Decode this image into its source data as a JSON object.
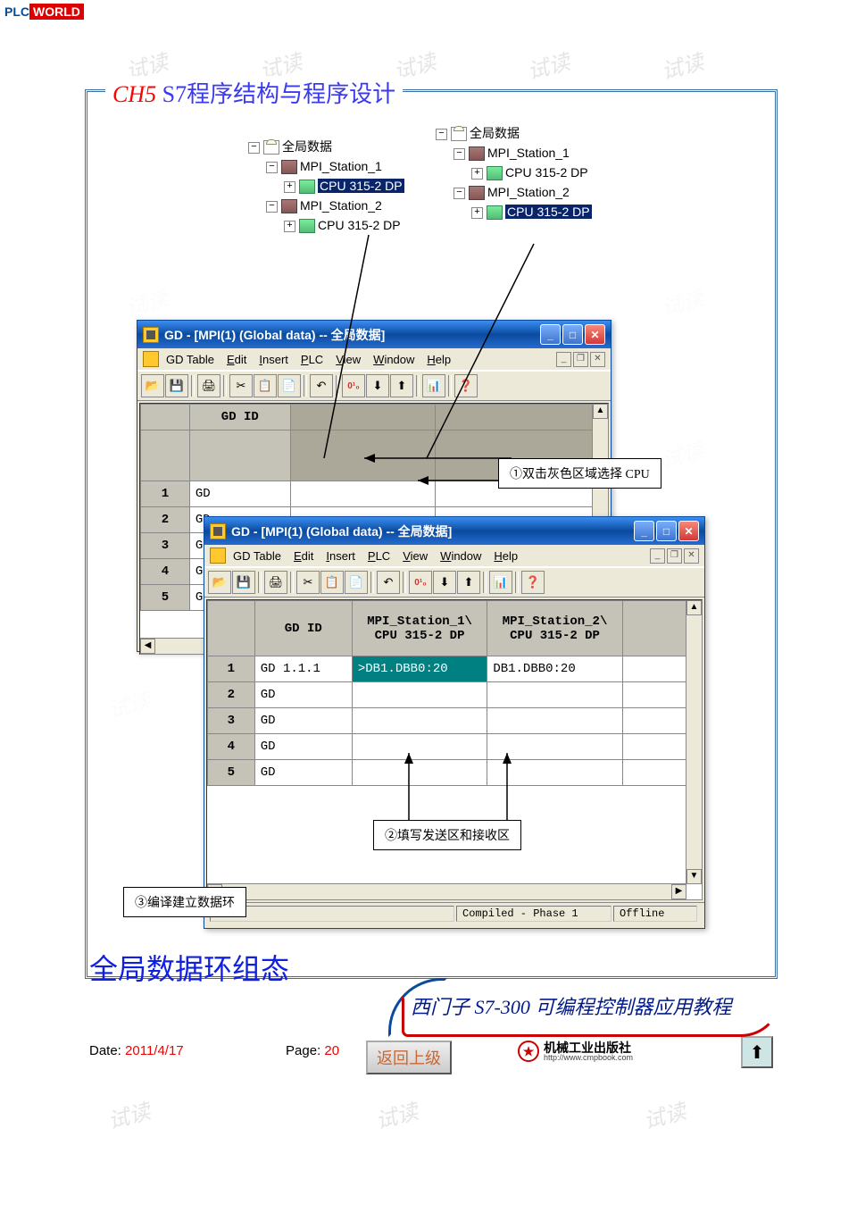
{
  "logo": {
    "p": "PLC",
    "w": "WORLD"
  },
  "watermark": "试读",
  "frame_title": {
    "chapter": "CH5",
    "text": "S7程序结构与程序设计"
  },
  "tree1": {
    "root": "全局数据",
    "s1": "MPI_Station_1",
    "c1": "CPU 315-2 DP",
    "s2": "MPI_Station_2",
    "c2": "CPU 315-2 DP"
  },
  "tree2": {
    "root": "全局数据",
    "s1": "MPI_Station_1",
    "c1": "CPU 315-2 DP",
    "s2": "MPI_Station_2",
    "c2": "CPU 315-2 DP"
  },
  "win1": {
    "title": "GD - [MPI(1) (Global data) -- 全局数据]",
    "menu": {
      "table": "GD Table",
      "edit": "Edit",
      "insert": "Insert",
      "plc": "PLC",
      "view": "View",
      "window": "Window",
      "help": "Help"
    },
    "col_gdid": "GD ID",
    "rows": [
      "GD",
      "GD",
      "GD",
      "GD",
      "GD"
    ]
  },
  "win2": {
    "title": "GD - [MPI(1) (Global data) -- 全局数据]",
    "menu": {
      "table": "GD Table",
      "edit": "Edit",
      "insert": "Insert",
      "plc": "PLC",
      "view": "View",
      "window": "Window",
      "help": "Help"
    },
    "col_gdid": "GD ID",
    "col_s1": "MPI_Station_1\\\nCPU 315-2 DP",
    "col_s2": "MPI_Station_2\\\nCPU 315-2 DP",
    "row1_id": "GD 1.1.1",
    "row1_v1": ">DB1.DBB0:20",
    "row1_v2": "DB1.DBB0:20",
    "rows_rest": [
      "GD",
      "GD",
      "GD",
      "GD"
    ],
    "status_left": "Compiled - Phase 1",
    "status_right": "Offline"
  },
  "callouts": {
    "c1": "①双击灰色区域选择 CPU",
    "c2": "②填写发送区和接收区",
    "c3": "③编译建立数据环"
  },
  "subtitle": "全局数据环组态",
  "book_title": "西门子 S7-300 可编程控制器应用教程",
  "footer": {
    "date_label": "Date: ",
    "date_value": "2011/4/17",
    "page_label": "Page: ",
    "page_value": "20",
    "return_btn": "返回上级",
    "publisher": "机械工业出版社",
    "publisher_url": "http://www.cmpbook.com"
  }
}
